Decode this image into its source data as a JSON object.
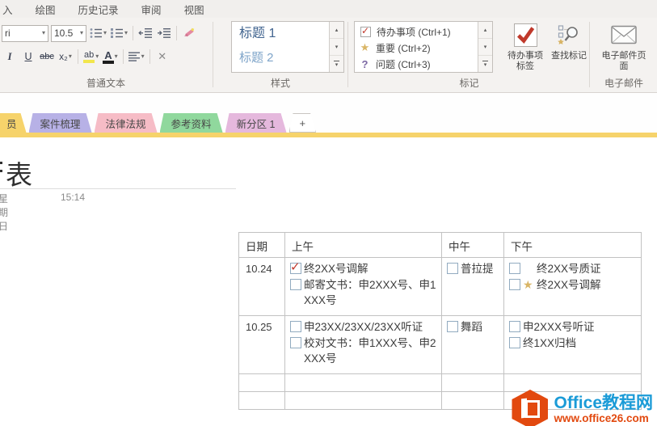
{
  "menubar": {
    "items": [
      "入",
      "绘图",
      "历史记录",
      "审阅",
      "视图"
    ]
  },
  "ribbon": {
    "basic_text": {
      "group_label": "普通文本",
      "font_name": "ri",
      "font_size": "10.5",
      "italic": "I",
      "underline": "U",
      "strikethrough": "abc",
      "subscript": "x₂",
      "highlight": "ab",
      "font_color": "A",
      "clear": "✕"
    },
    "styles": {
      "group_label": "样式",
      "items": [
        {
          "label": "标题 1",
          "color": "#41648f"
        },
        {
          "label": "标题 2",
          "color": "#7ea4c9"
        }
      ]
    },
    "tags": {
      "group_label": "标记",
      "items": [
        {
          "icon": "todo-checkbox",
          "label": "待办事项 (Ctrl+1)"
        },
        {
          "icon": "important-star",
          "label": "重要 (Ctrl+2)"
        },
        {
          "icon": "question-mark",
          "label": "问题 (Ctrl+3)"
        }
      ],
      "todo_tag_button": "待办事项标签",
      "find_tags_button": "查找标记"
    },
    "email": {
      "group_label": "电子邮件",
      "email_page_button": "电子邮件页面"
    }
  },
  "section_tabs": {
    "accent_color": "#f6d36b",
    "tabs": [
      {
        "label": "员",
        "color": "#f6d36b",
        "active": true
      },
      {
        "label": "案件梳理",
        "color": "#b7b1e6",
        "active": false
      },
      {
        "label": "法律法规",
        "color": "#f6bcc6",
        "active": false
      },
      {
        "label": "参考资料",
        "color": "#90d89d",
        "active": false
      },
      {
        "label": "新分区 1",
        "color": "#e5b8dd",
        "active": false
      },
      {
        "label": "+",
        "color": "#ffffff",
        "active": false
      }
    ]
  },
  "page": {
    "title": "表",
    "weekday": "星期日",
    "time": "15:14"
  },
  "table": {
    "headers": [
      "日期",
      "上午",
      "中午",
      "下午"
    ],
    "rows": [
      {
        "date": "10.24",
        "morning": [
          {
            "checked": true,
            "text": "终2XX号调解"
          },
          {
            "checked": false,
            "text": "邮寄文书：申2XXX号、申1XXX号"
          }
        ],
        "noon": [
          {
            "checked": false,
            "text": "普拉提"
          }
        ],
        "afternoon": [
          {
            "checked": false,
            "indent": true,
            "text": "终2XX号质证"
          },
          {
            "checked": false,
            "star": true,
            "text": "终2XX号调解"
          }
        ]
      },
      {
        "date": "10.25",
        "morning": [
          {
            "checked": false,
            "text": "申23XX/23XX/23XX听证"
          },
          {
            "checked": false,
            "text": "校对文书：申1XXX号、申2XXX号"
          }
        ],
        "noon": [
          {
            "checked": false,
            "text": "舞蹈"
          }
        ],
        "afternoon": [
          {
            "checked": false,
            "text": "申2XXX号听证"
          },
          {
            "checked": false,
            "text": "终1XX归档"
          }
        ]
      },
      {
        "date": "",
        "morning": [],
        "noon": [],
        "afternoon": []
      },
      {
        "date": "",
        "morning": [],
        "noon": [],
        "afternoon": []
      }
    ]
  },
  "watermark": {
    "title": "Office教程网",
    "url": "www.office26.com"
  }
}
